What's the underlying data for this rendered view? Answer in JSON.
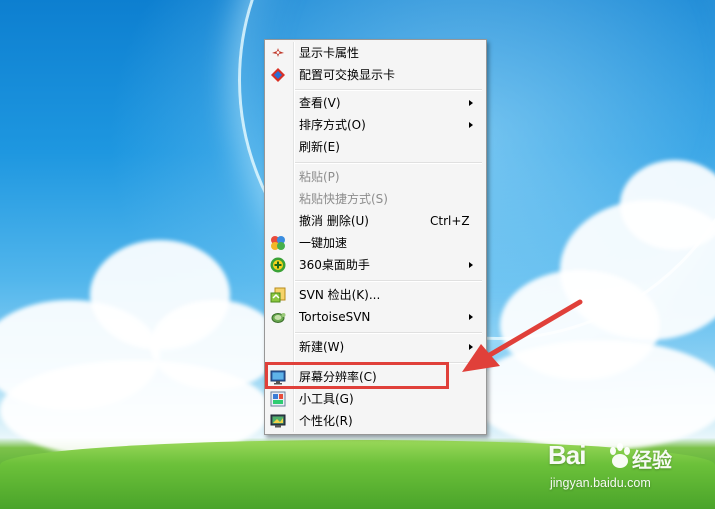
{
  "context_menu": {
    "items": [
      {
        "label": "显示卡属性",
        "icon": "graphics-card-icon"
      },
      {
        "label": "配置可交换显示卡",
        "icon": "switchable-graphics-icon"
      },
      {
        "label": "查看(V)",
        "submenu": true
      },
      {
        "label": "排序方式(O)",
        "submenu": true
      },
      {
        "label": "刷新(E)"
      },
      {
        "label": "粘贴(P)",
        "disabled": true
      },
      {
        "label": "粘贴快捷方式(S)",
        "disabled": true
      },
      {
        "label": "撤消 删除(U)",
        "shortcut": "Ctrl+Z"
      },
      {
        "label": "一键加速",
        "icon": "speed-up-icon"
      },
      {
        "label": "360桌面助手",
        "icon": "360-desktop-icon",
        "submenu": true
      },
      {
        "label": "SVN 检出(K)...",
        "icon": "svn-checkout-icon"
      },
      {
        "label": "TortoiseSVN",
        "icon": "tortoisesvn-icon",
        "submenu": true
      },
      {
        "label": "新建(W)",
        "submenu": true
      },
      {
        "label": "屏幕分辨率(C)",
        "icon": "screen-resolution-icon",
        "highlighted": true
      },
      {
        "label": "小工具(G)",
        "icon": "gadgets-icon"
      },
      {
        "label": "个性化(R)",
        "icon": "personalize-icon"
      }
    ]
  },
  "annotation": {
    "color": "#e0403a"
  },
  "watermark": {
    "logo": "Bai  ",
    "logo_cn": "经验",
    "url": "jingyan.baidu.com"
  }
}
